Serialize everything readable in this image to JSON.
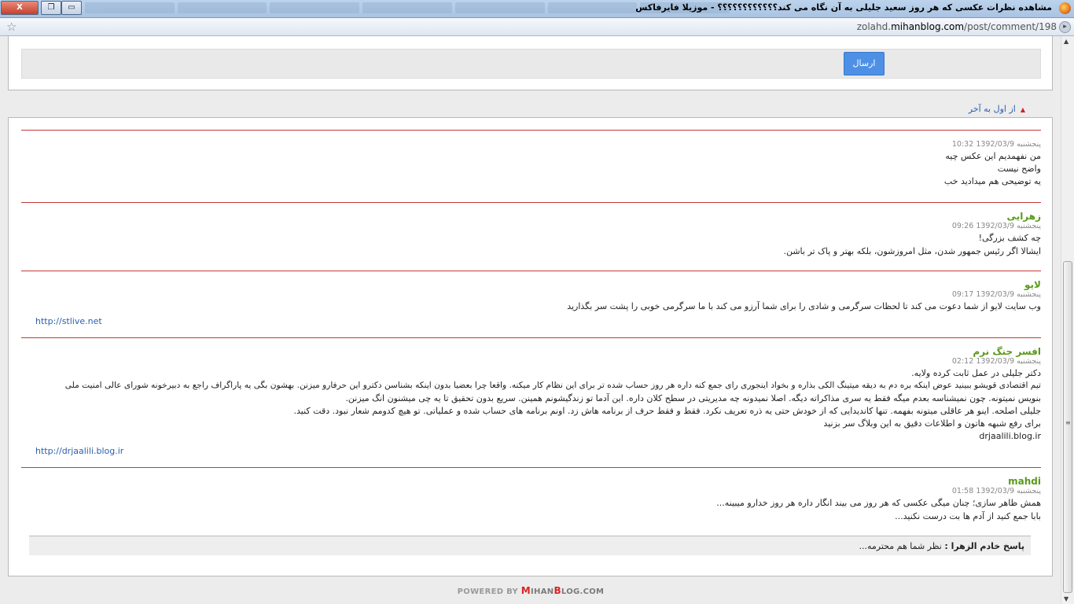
{
  "window": {
    "title": "مشاهده نظرات عکسی که هر روز سعید جلیلی به آن نگاه می کند؟؟؟؟؟؟؟؟؟؟؟؟ - موزیلا فایرفاکس",
    "close_label": "X",
    "restore_label": "❐",
    "minimize_label": "▭"
  },
  "urlbar": {
    "url_prefix": "zolahd.",
    "url_domain": "mihanblog.com",
    "url_path": "/post/comment/198"
  },
  "form": {
    "send_label": "ارسال"
  },
  "sort": {
    "label": "از اول به آخر"
  },
  "comments": [
    {
      "author": "",
      "date": "پنجشنبه 1392/03/9 10:32",
      "lines": [
        "من نفهمدیم این عکس چیه",
        "واضح نیست",
        "یه توضیحی هم میدادید خب"
      ],
      "link": ""
    },
    {
      "author": "زهرایی",
      "date": "پنجشنبه 1392/03/9 09:26",
      "lines": [
        "چه کشف بزرگی!",
        "ایشالا اگر رئیس جمهور شدن، مثل امروزشون، بلکه بهتر و پاک تر باشن."
      ],
      "link": ""
    },
    {
      "author": "لایو",
      "date": "پنجشنبه 1392/03/9 09:17",
      "lines": [
        "وب سایت لایو از شما دعوت می کند تا لحظات سرگرمی و شادی را برای شما آرزو می کند با ما سرگرمی خوبی را پشت سر بگذارید"
      ],
      "link": "http://stlive.net"
    },
    {
      "author": "افسر جنگ نرم",
      "date": "پنجشنبه 1392/03/9 02:12",
      "lines": [
        "دکتر جلیلی در عمل ثابت کرده ولایه.",
        "تیم اقتصادی قویشو ببینید عوض اینکه بره دم به دیقه میتینگ الکی بذاره و بخواد اینجوری رای جمع کنه داره هر روز حساب شده تر برای این نظام کار میکنه. واقعا چرا بعضیا بدون اینکه بشناسن دکترو این حرفارو میزنن. بهشون بگی یه پاراگراف راجع به دبیرخونه شورای عالی امنیت ملی",
        "بنویس نمیتونه. چون نمیشناسه بعدم میگه فقط یه سری مذاکراته دیگه. اصلا نمیدونه چه مدیریتی در سطح کلان داره. این آدما تو زندگیشونم همینن. سریع بدون تحقیق تا یه چی میشنون انگ میزنن.",
        "جلیلی اصلحه. اینو هر عاقلی میتونه بفهمه. تنها کاندیدایی که از خودش حتی یه ذره تعریف نکرد. فقط و فقط حرف از برنامه هاش زد. اونم برنامه های حساب شده و عملیاتی. تو هیچ کدومم شعار نبود. دقت کنید.",
        "برای رفع شبهه هاتون و اطلاعات دقیق به این وبلاگ سر بزنید",
        "drjaalili.blog.ir"
      ],
      "link": "http://drjaalili.blog.ir"
    },
    {
      "author": "mahdi",
      "date": "پنجشنبه 1392/03/9 01:58",
      "lines": [
        "همش ظاهر سازی؛ چنان میگی عکسی که هر روز می بیند انگار داره هر روز خدارو میبینه...",
        "بابا جمع کنید از آدم ها بت درست نکنید..."
      ],
      "link": ""
    }
  ],
  "reply": {
    "author": "پاسخ خادم الزهرا :",
    "text": " نظر شما هم محترمه..."
  },
  "footer": {
    "powered_prefix": "POWERED BY ",
    "brand_m": "M",
    "brand_ihan": "IHAN",
    "brand_b": "B",
    "brand_rest": "LOG.COM"
  }
}
